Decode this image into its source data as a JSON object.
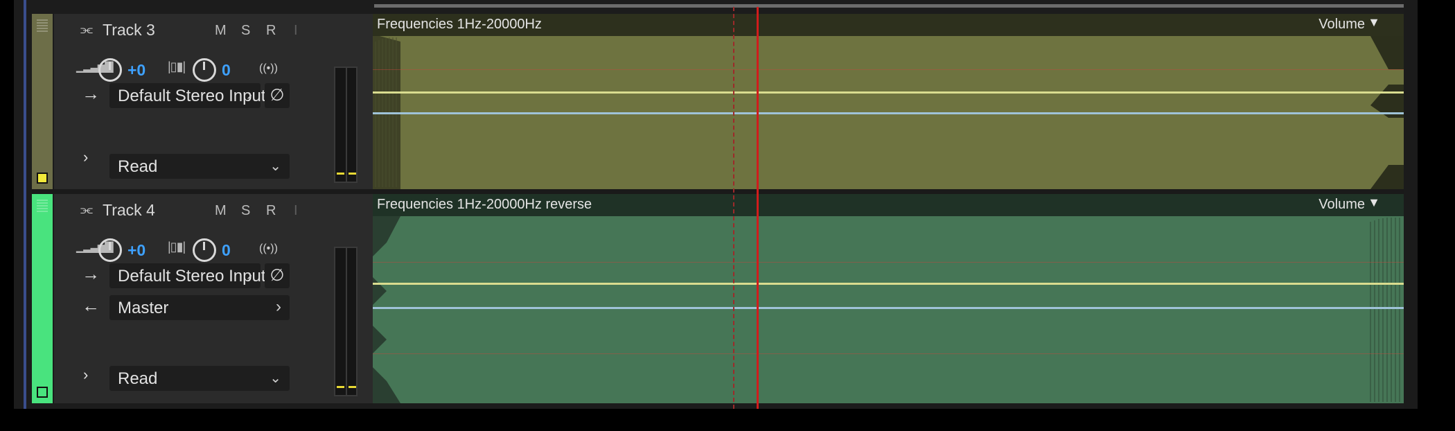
{
  "tracks": [
    {
      "name": "Track 3",
      "mute_label": "M",
      "solo_label": "S",
      "record_label": "R",
      "input_monitor_label": "I",
      "volume_value": "+0",
      "pan_value": "0",
      "input_label": "Default Stereo Input",
      "automation_mode": "Read",
      "clip_title": "Frequencies 1Hz-20000Hz",
      "lane_param": "Volume",
      "color": "#f1e93a"
    },
    {
      "name": "Track 4",
      "mute_label": "M",
      "solo_label": "S",
      "record_label": "R",
      "input_monitor_label": "I",
      "volume_value": "+0",
      "pan_value": "0",
      "input_label": "Default Stereo Input",
      "output_label": "Master",
      "automation_mode": "Read",
      "clip_title": "Frequencies 1Hz-20000Hz reverse",
      "lane_param": "Volume",
      "color": "#49e37e"
    }
  ],
  "icons": {
    "track_type": "waveform-icon",
    "volume": "volume-ramp-icon",
    "pan": "pan-icon",
    "input_arrow": "arrow-right-icon",
    "output_arrow": "arrow-left-icon",
    "phase": "phase-invert-icon",
    "stereo": "stereo-icon",
    "expand": "chevron-right-icon",
    "dropdown": "chevron-down-icon"
  }
}
